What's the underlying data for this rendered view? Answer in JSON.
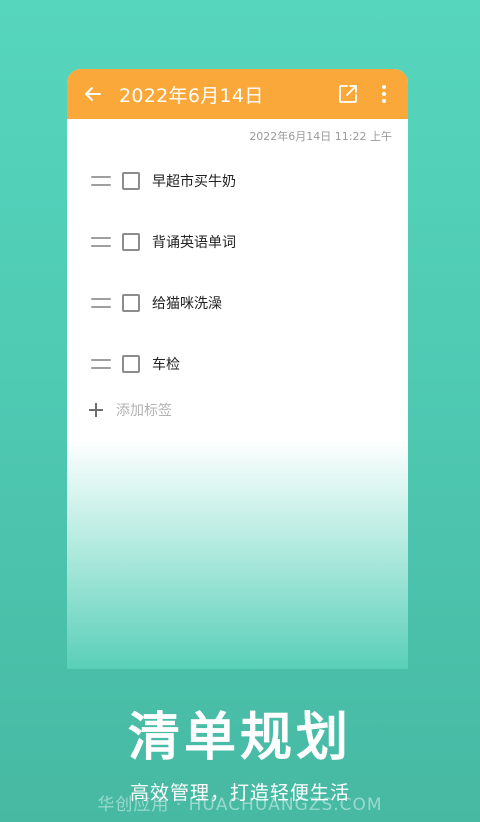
{
  "header": {
    "title": "2022年6月14日",
    "back_icon": "arrow-left-icon",
    "share_icon": "share-export-icon",
    "more_icon": "more-vertical-icon",
    "accent_color": "#fba83a"
  },
  "note": {
    "timestamp": "2022年6月14日 11:22 上午",
    "items": [
      {
        "label": "早超市买牛奶",
        "checked": false
      },
      {
        "label": "背诵英语单词",
        "checked": false
      },
      {
        "label": "给猫咪洗澡",
        "checked": false
      },
      {
        "label": "车检",
        "checked": false
      }
    ],
    "add_tag_label": "添加标签"
  },
  "promo": {
    "headline": "清单规划",
    "subline": "高效管理，打造轻便生活",
    "watermark": "华创应用 · HUACHUANGZS.COM"
  },
  "theme": {
    "background": "#52cdb5",
    "card": "#ffffff"
  }
}
